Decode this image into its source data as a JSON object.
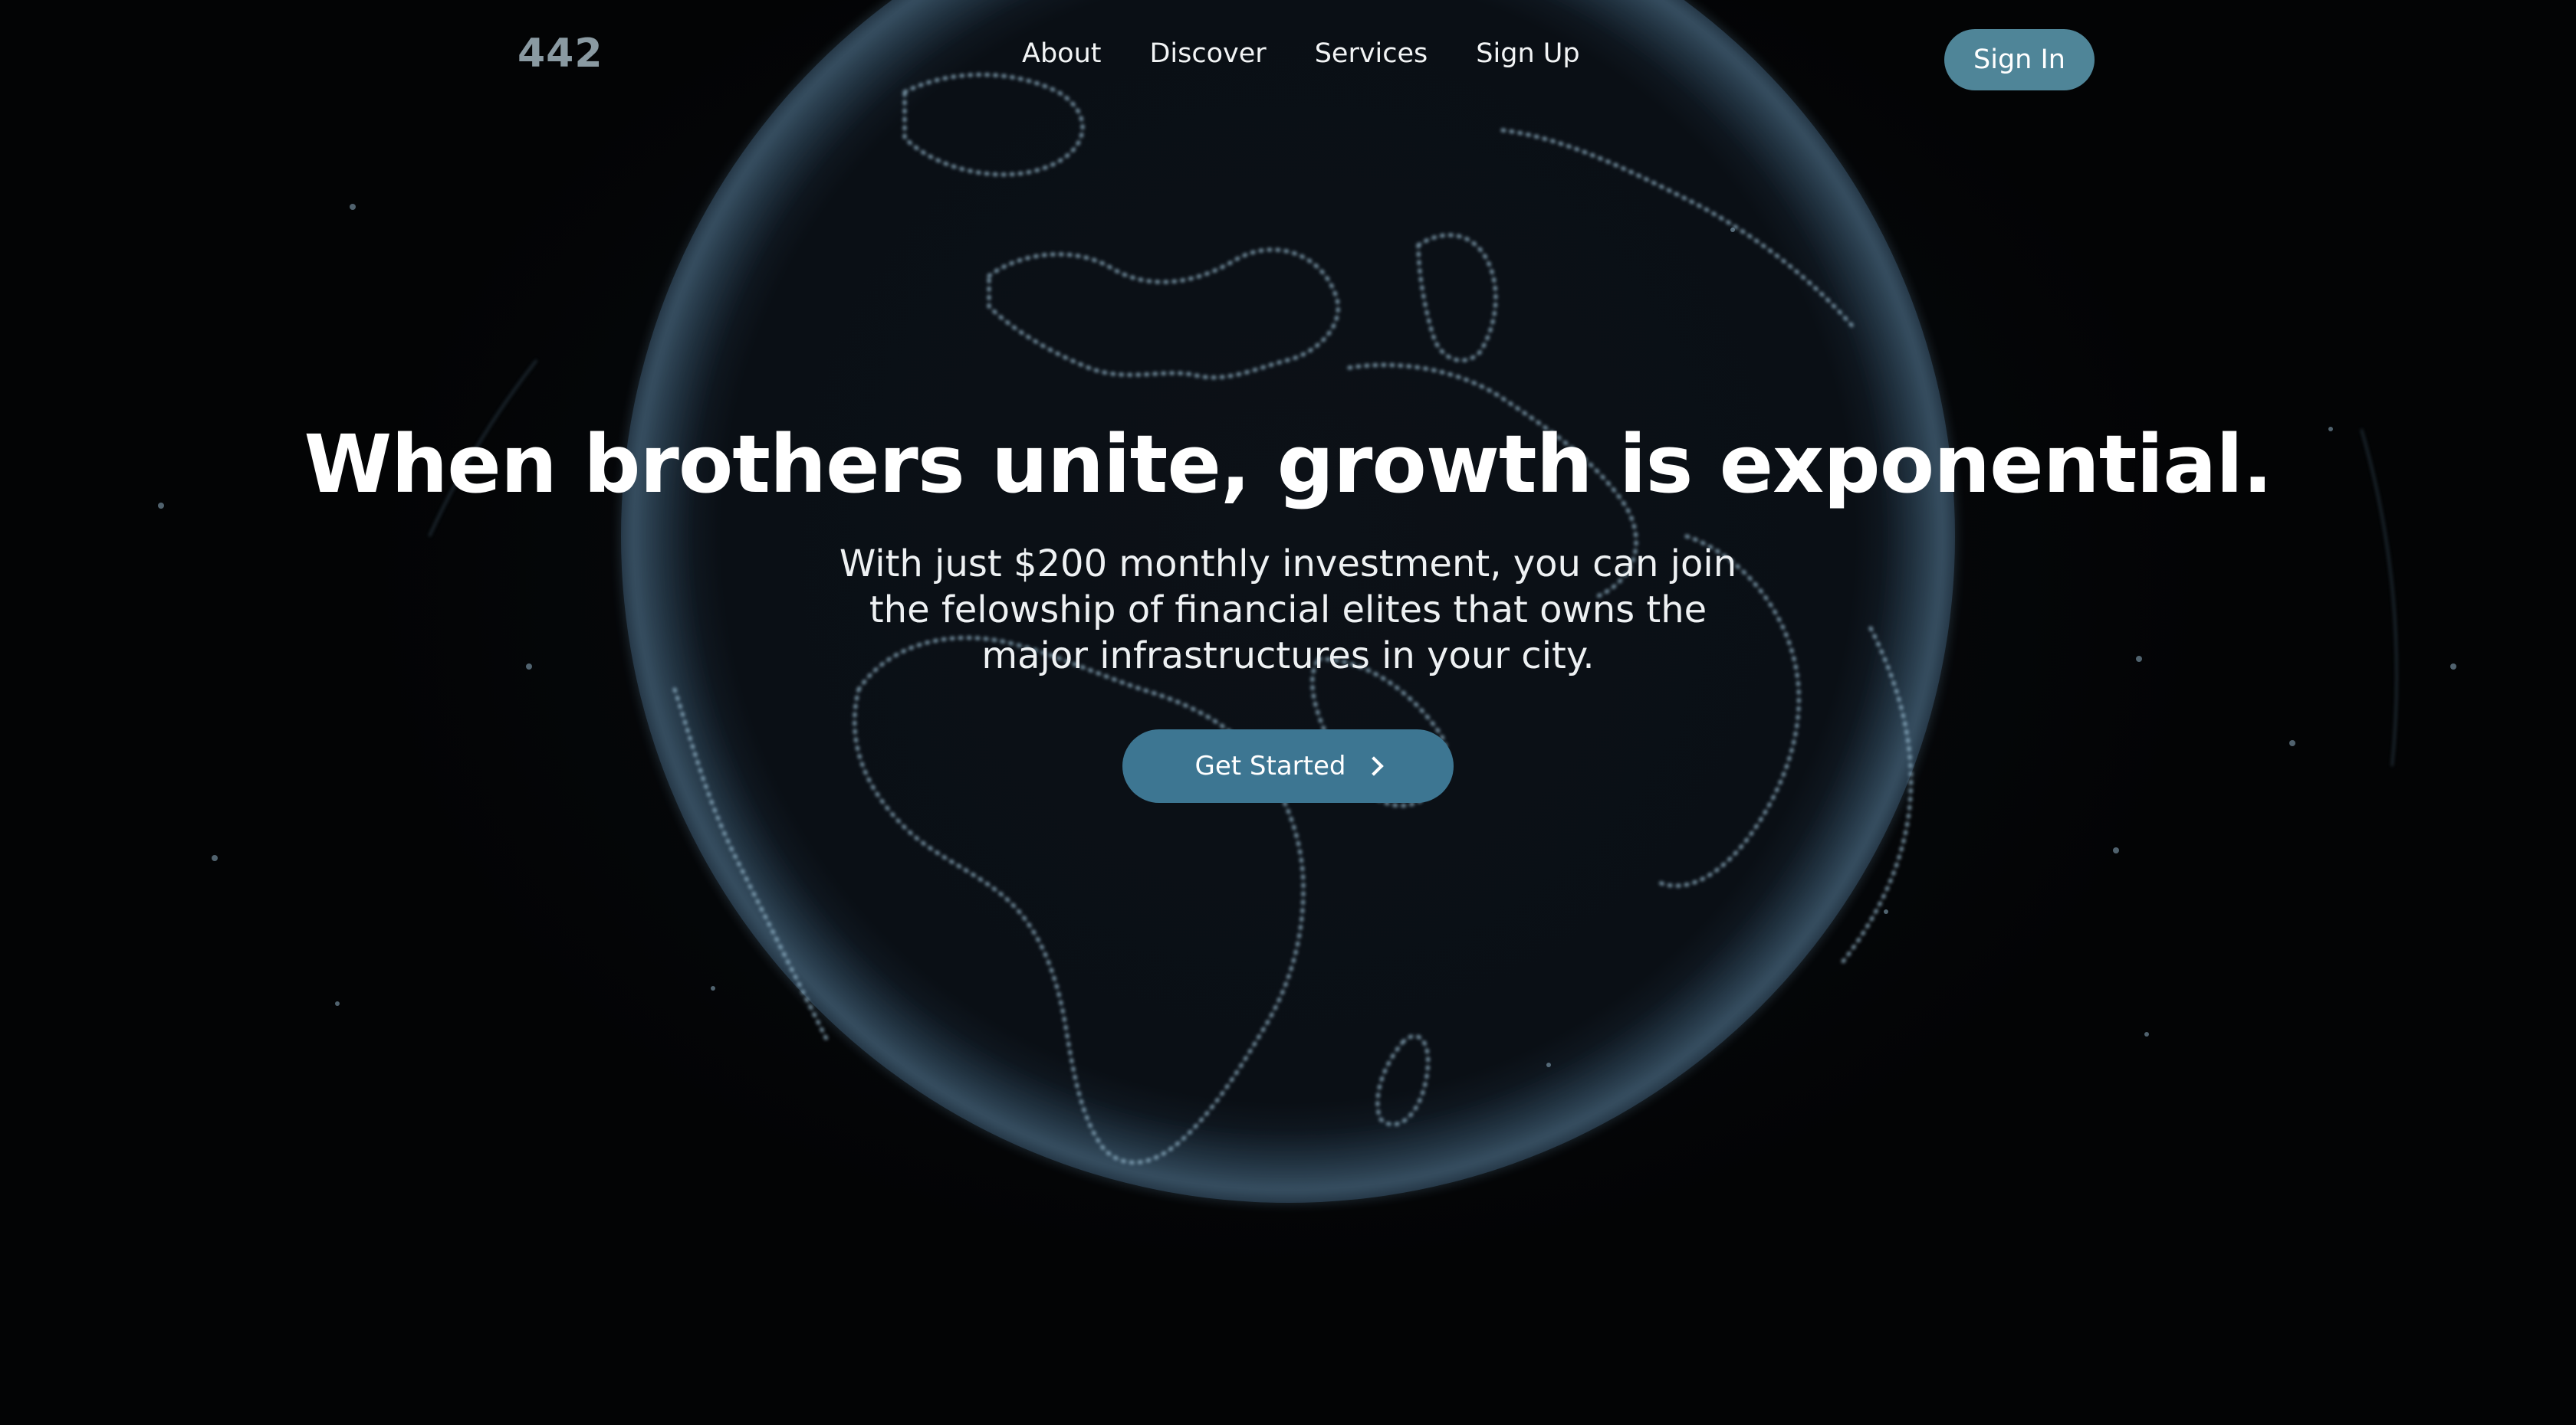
{
  "brand": {
    "logo_text": "442"
  },
  "nav": {
    "links": [
      {
        "label": "About"
      },
      {
        "label": "Discover"
      },
      {
        "label": "Services"
      },
      {
        "label": "Sign Up"
      }
    ],
    "signin_label": "Sign In"
  },
  "hero": {
    "title": "When brothers unite, growth is exponential.",
    "subtitle": "With just $200 monthly investment, you can join the felowship of financial elites that owns the major infrastructures in your city.",
    "cta_label": "Get Started",
    "cta_icon": "chevron-right-icon"
  },
  "colors": {
    "background": "#030405",
    "signin_button": "#4f8598",
    "cta_button": "#3d7692",
    "logo": "#8a9aa2",
    "globe_dots": "#9fc3d8"
  }
}
